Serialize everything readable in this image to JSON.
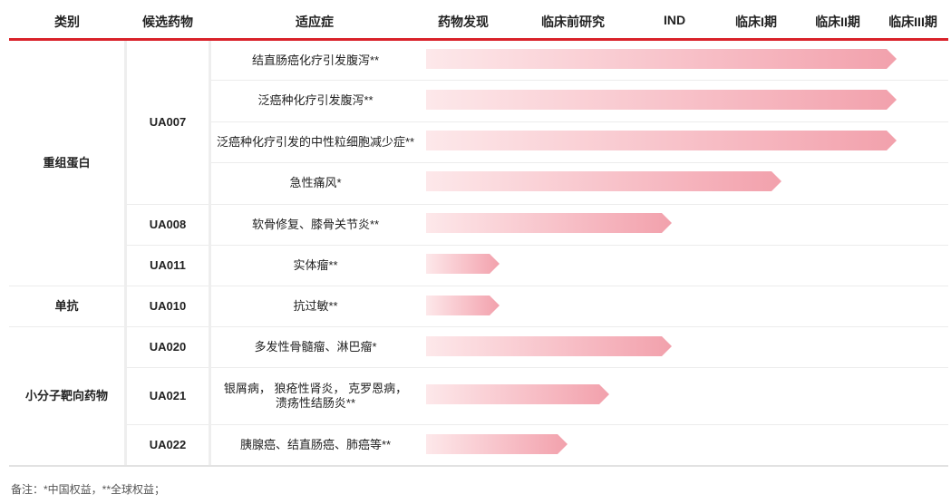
{
  "headers": [
    "类别",
    "候选药物",
    "适应症",
    "药物发现",
    "临床前研究",
    "IND",
    "临床I期",
    "临床II期",
    "临床III期"
  ],
  "categories": [
    "重组蛋白",
    "单抗",
    "小分子靶向药物"
  ],
  "candidates": [
    "UA007",
    "UA008",
    "UA011",
    "UA010",
    "UA020",
    "UA021",
    "UA022"
  ],
  "rows": [
    {
      "indication": "结直肠癌化疗引发腹泻**",
      "progress": 0.9
    },
    {
      "indication": "泛癌种化疗引发腹泻**",
      "progress": 0.9
    },
    {
      "indication": "泛癌种化疗引发的中性粒细胞减少症**",
      "progress": 0.9
    },
    {
      "indication": "急性痛风*",
      "progress": 0.68
    },
    {
      "indication": "软骨修复、膝骨关节炎**",
      "progress": 0.47
    },
    {
      "indication": "实体瘤**",
      "progress": 0.14
    },
    {
      "indication": "抗过敏**",
      "progress": 0.14
    },
    {
      "indication": "多发性骨髓瘤、淋巴瘤*",
      "progress": 0.47
    },
    {
      "indication": "银屑病，  狼疮性肾炎，  克罗恩病，\n溃疡性结肠炎**",
      "progress": 0.35
    },
    {
      "indication": "胰腺癌、结直肠癌、肺癌等**",
      "progress": 0.27
    }
  ],
  "footnote": "备注：*中国权益，**全球权益；",
  "colors": {
    "accent": "#d9222a",
    "bar_start": "#fde8ea",
    "bar_end": "#f2a1ac"
  }
}
